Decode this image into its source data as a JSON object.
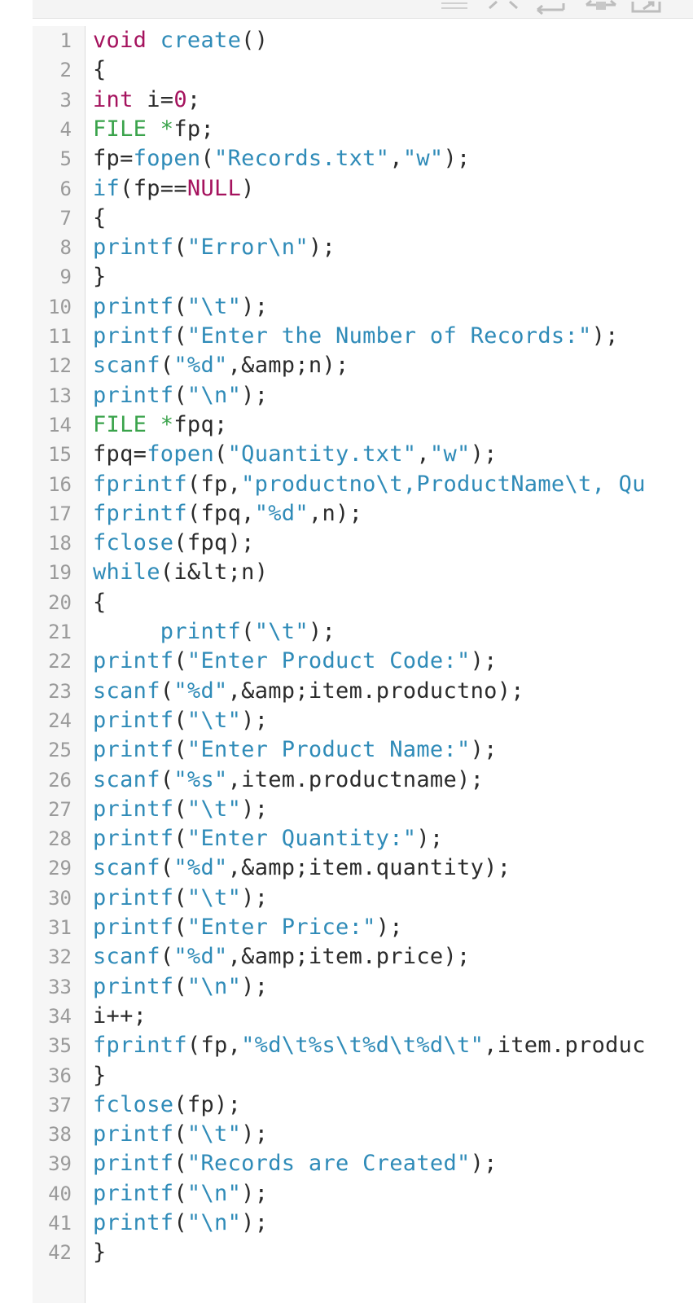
{
  "editor": {
    "language": "c",
    "colors": {
      "keyword": "#a5135e",
      "type": "#3aa34b",
      "function": "#2f8bb8",
      "string": "#2f8bb8",
      "number": "#a5135e",
      "constant": "#a5135e",
      "identifier": "#2b2b2b",
      "line_number": "#9a9a9a",
      "gutter_bg": "#f6f6f6"
    },
    "toolbar_icons": [
      "menu-icon",
      "code-icon",
      "wrap-icon",
      "swap-icon",
      "expand-icon"
    ],
    "lines": [
      {
        "n": "1",
        "indent": "",
        "tokens": [
          [
            "kw",
            "void"
          ],
          [
            "id",
            " "
          ],
          [
            "fn",
            "create"
          ],
          [
            "pun",
            "()"
          ]
        ]
      },
      {
        "n": "2",
        "indent": "",
        "tokens": [
          [
            "pun",
            "{"
          ]
        ]
      },
      {
        "n": "3",
        "indent": "",
        "tokens": [
          [
            "kw",
            "int"
          ],
          [
            "id",
            " i="
          ],
          [
            "num",
            "0"
          ],
          [
            "pun",
            ";"
          ]
        ]
      },
      {
        "n": "4",
        "indent": "",
        "tokens": [
          [
            "type",
            "FILE"
          ],
          [
            "id",
            " "
          ],
          [
            "type",
            "*"
          ],
          [
            "id",
            "fp;"
          ]
        ]
      },
      {
        "n": "5",
        "indent": "",
        "tokens": [
          [
            "id",
            "fp="
          ],
          [
            "fn",
            "fopen"
          ],
          [
            "pun",
            "("
          ],
          [
            "str",
            "\"Records.txt\""
          ],
          [
            "pun",
            ","
          ],
          [
            "str",
            "\"w\""
          ],
          [
            "pun",
            ");"
          ]
        ]
      },
      {
        "n": "6",
        "indent": "",
        "tokens": [
          [
            "fn",
            "if"
          ],
          [
            "pun",
            "("
          ],
          [
            "id",
            "fp=="
          ],
          [
            "con",
            "NULL"
          ],
          [
            "pun",
            ")"
          ]
        ]
      },
      {
        "n": "7",
        "indent": "",
        "tokens": [
          [
            "pun",
            "{"
          ]
        ]
      },
      {
        "n": "8",
        "indent": "",
        "tokens": [
          [
            "fn",
            "printf"
          ],
          [
            "pun",
            "("
          ],
          [
            "str",
            "\"Error\\n\""
          ],
          [
            "pun",
            ");"
          ]
        ]
      },
      {
        "n": "9",
        "indent": "",
        "tokens": [
          [
            "pun",
            "}"
          ]
        ]
      },
      {
        "n": "10",
        "indent": "",
        "tokens": [
          [
            "fn",
            "printf"
          ],
          [
            "pun",
            "("
          ],
          [
            "str",
            "\"\\t\""
          ],
          [
            "pun",
            ");"
          ]
        ]
      },
      {
        "n": "11",
        "indent": "",
        "tokens": [
          [
            "fn",
            "printf"
          ],
          [
            "pun",
            "("
          ],
          [
            "str",
            "\"Enter the Number of Records:\""
          ],
          [
            "pun",
            ");"
          ]
        ]
      },
      {
        "n": "12",
        "indent": "",
        "tokens": [
          [
            "fn",
            "scanf"
          ],
          [
            "pun",
            "("
          ],
          [
            "str",
            "\"%d\""
          ],
          [
            "pun",
            ","
          ],
          [
            "id",
            "&amp;n"
          ],
          [
            "pun",
            ");"
          ]
        ]
      },
      {
        "n": "13",
        "indent": "",
        "tokens": [
          [
            "fn",
            "printf"
          ],
          [
            "pun",
            "("
          ],
          [
            "str",
            "\"\\n\""
          ],
          [
            "pun",
            ");"
          ]
        ]
      },
      {
        "n": "14",
        "indent": "",
        "tokens": [
          [
            "type",
            "FILE"
          ],
          [
            "id",
            " "
          ],
          [
            "type",
            "*"
          ],
          [
            "id",
            "fpq;"
          ]
        ]
      },
      {
        "n": "15",
        "indent": "",
        "tokens": [
          [
            "id",
            "fpq="
          ],
          [
            "fn",
            "fopen"
          ],
          [
            "pun",
            "("
          ],
          [
            "str",
            "\"Quantity.txt\""
          ],
          [
            "pun",
            ","
          ],
          [
            "str",
            "\"w\""
          ],
          [
            "pun",
            ");"
          ]
        ]
      },
      {
        "n": "16",
        "indent": "",
        "tokens": [
          [
            "fn",
            "fprintf"
          ],
          [
            "pun",
            "("
          ],
          [
            "id",
            "fp,"
          ],
          [
            "str",
            "\"productno\\t,ProductName\\t, Qu"
          ]
        ]
      },
      {
        "n": "17",
        "indent": "",
        "tokens": [
          [
            "fn",
            "fprintf"
          ],
          [
            "pun",
            "("
          ],
          [
            "id",
            "fpq,"
          ],
          [
            "str",
            "\"%d\""
          ],
          [
            "pun",
            ","
          ],
          [
            "id",
            "n"
          ],
          [
            "pun",
            ");"
          ]
        ]
      },
      {
        "n": "18",
        "indent": "",
        "tokens": [
          [
            "fn",
            "fclose"
          ],
          [
            "pun",
            "("
          ],
          [
            "id",
            "fpq"
          ],
          [
            "pun",
            ");"
          ]
        ]
      },
      {
        "n": "19",
        "indent": "",
        "tokens": [
          [
            "fn",
            "while"
          ],
          [
            "pun",
            "("
          ],
          [
            "id",
            "i&lt;n"
          ],
          [
            "pun",
            ")"
          ]
        ]
      },
      {
        "n": "20",
        "indent": "",
        "tokens": [
          [
            "pun",
            "{"
          ]
        ]
      },
      {
        "n": "21",
        "indent": "     ",
        "tokens": [
          [
            "fn",
            "printf"
          ],
          [
            "pun",
            "("
          ],
          [
            "str",
            "\"\\t\""
          ],
          [
            "pun",
            ");"
          ]
        ]
      },
      {
        "n": "22",
        "indent": "",
        "tokens": [
          [
            "fn",
            "printf"
          ],
          [
            "pun",
            "("
          ],
          [
            "str",
            "\"Enter Product Code:\""
          ],
          [
            "pun",
            ");"
          ]
        ]
      },
      {
        "n": "23",
        "indent": "",
        "tokens": [
          [
            "fn",
            "scanf"
          ],
          [
            "pun",
            "("
          ],
          [
            "str",
            "\"%d\""
          ],
          [
            "pun",
            ","
          ],
          [
            "id",
            "&amp;item.productno"
          ],
          [
            "pun",
            ");"
          ]
        ]
      },
      {
        "n": "24",
        "indent": "",
        "tokens": [
          [
            "fn",
            "printf"
          ],
          [
            "pun",
            "("
          ],
          [
            "str",
            "\"\\t\""
          ],
          [
            "pun",
            ");"
          ]
        ]
      },
      {
        "n": "25",
        "indent": "",
        "tokens": [
          [
            "fn",
            "printf"
          ],
          [
            "pun",
            "("
          ],
          [
            "str",
            "\"Enter Product Name:\""
          ],
          [
            "pun",
            ");"
          ]
        ]
      },
      {
        "n": "26",
        "indent": "",
        "tokens": [
          [
            "fn",
            "scanf"
          ],
          [
            "pun",
            "("
          ],
          [
            "str",
            "\"%s\""
          ],
          [
            "pun",
            ","
          ],
          [
            "id",
            "item.productname"
          ],
          [
            "pun",
            ");"
          ]
        ]
      },
      {
        "n": "27",
        "indent": "",
        "tokens": [
          [
            "fn",
            "printf"
          ],
          [
            "pun",
            "("
          ],
          [
            "str",
            "\"\\t\""
          ],
          [
            "pun",
            ");"
          ]
        ]
      },
      {
        "n": "28",
        "indent": "",
        "tokens": [
          [
            "fn",
            "printf"
          ],
          [
            "pun",
            "("
          ],
          [
            "str",
            "\"Enter Quantity:\""
          ],
          [
            "pun",
            ");"
          ]
        ]
      },
      {
        "n": "29",
        "indent": "",
        "tokens": [
          [
            "fn",
            "scanf"
          ],
          [
            "pun",
            "("
          ],
          [
            "str",
            "\"%d\""
          ],
          [
            "pun",
            ","
          ],
          [
            "id",
            "&amp;item.quantity"
          ],
          [
            "pun",
            ");"
          ]
        ]
      },
      {
        "n": "30",
        "indent": "",
        "tokens": [
          [
            "fn",
            "printf"
          ],
          [
            "pun",
            "("
          ],
          [
            "str",
            "\"\\t\""
          ],
          [
            "pun",
            ");"
          ]
        ]
      },
      {
        "n": "31",
        "indent": "",
        "tokens": [
          [
            "fn",
            "printf"
          ],
          [
            "pun",
            "("
          ],
          [
            "str",
            "\"Enter Price:\""
          ],
          [
            "pun",
            ");"
          ]
        ]
      },
      {
        "n": "32",
        "indent": "",
        "tokens": [
          [
            "fn",
            "scanf"
          ],
          [
            "pun",
            "("
          ],
          [
            "str",
            "\"%d\""
          ],
          [
            "pun",
            ","
          ],
          [
            "id",
            "&amp;item.price"
          ],
          [
            "pun",
            ");"
          ]
        ]
      },
      {
        "n": "33",
        "indent": "",
        "tokens": [
          [
            "fn",
            "printf"
          ],
          [
            "pun",
            "("
          ],
          [
            "str",
            "\"\\n\""
          ],
          [
            "pun",
            ");"
          ]
        ]
      },
      {
        "n": "34",
        "indent": "",
        "tokens": [
          [
            "id",
            "i++;"
          ]
        ]
      },
      {
        "n": "35",
        "indent": "",
        "tokens": [
          [
            "fn",
            "fprintf"
          ],
          [
            "pun",
            "("
          ],
          [
            "id",
            "fp,"
          ],
          [
            "str",
            "\"%d\\t%s\\t%d\\t%d\\t\""
          ],
          [
            "pun",
            ","
          ],
          [
            "id",
            "item.produc"
          ]
        ]
      },
      {
        "n": "36",
        "indent": "",
        "tokens": [
          [
            "pun",
            "}"
          ]
        ]
      },
      {
        "n": "37",
        "indent": "",
        "tokens": [
          [
            "fn",
            "fclose"
          ],
          [
            "pun",
            "("
          ],
          [
            "id",
            "fp"
          ],
          [
            "pun",
            ");"
          ]
        ]
      },
      {
        "n": "38",
        "indent": "",
        "tokens": [
          [
            "fn",
            "printf"
          ],
          [
            "pun",
            "("
          ],
          [
            "str",
            "\"\\t\""
          ],
          [
            "pun",
            ");"
          ]
        ]
      },
      {
        "n": "39",
        "indent": "",
        "tokens": [
          [
            "fn",
            "printf"
          ],
          [
            "pun",
            "("
          ],
          [
            "str",
            "\"Records are Created\""
          ],
          [
            "pun",
            ");"
          ]
        ]
      },
      {
        "n": "40",
        "indent": "",
        "tokens": [
          [
            "fn",
            "printf"
          ],
          [
            "pun",
            "("
          ],
          [
            "str",
            "\"\\n\""
          ],
          [
            "pun",
            ");"
          ]
        ]
      },
      {
        "n": "41",
        "indent": "",
        "tokens": [
          [
            "fn",
            "printf"
          ],
          [
            "pun",
            "("
          ],
          [
            "str",
            "\"\\n\""
          ],
          [
            "pun",
            ");"
          ]
        ]
      },
      {
        "n": "42",
        "indent": "",
        "tokens": [
          [
            "pun",
            "}"
          ]
        ]
      }
    ]
  }
}
